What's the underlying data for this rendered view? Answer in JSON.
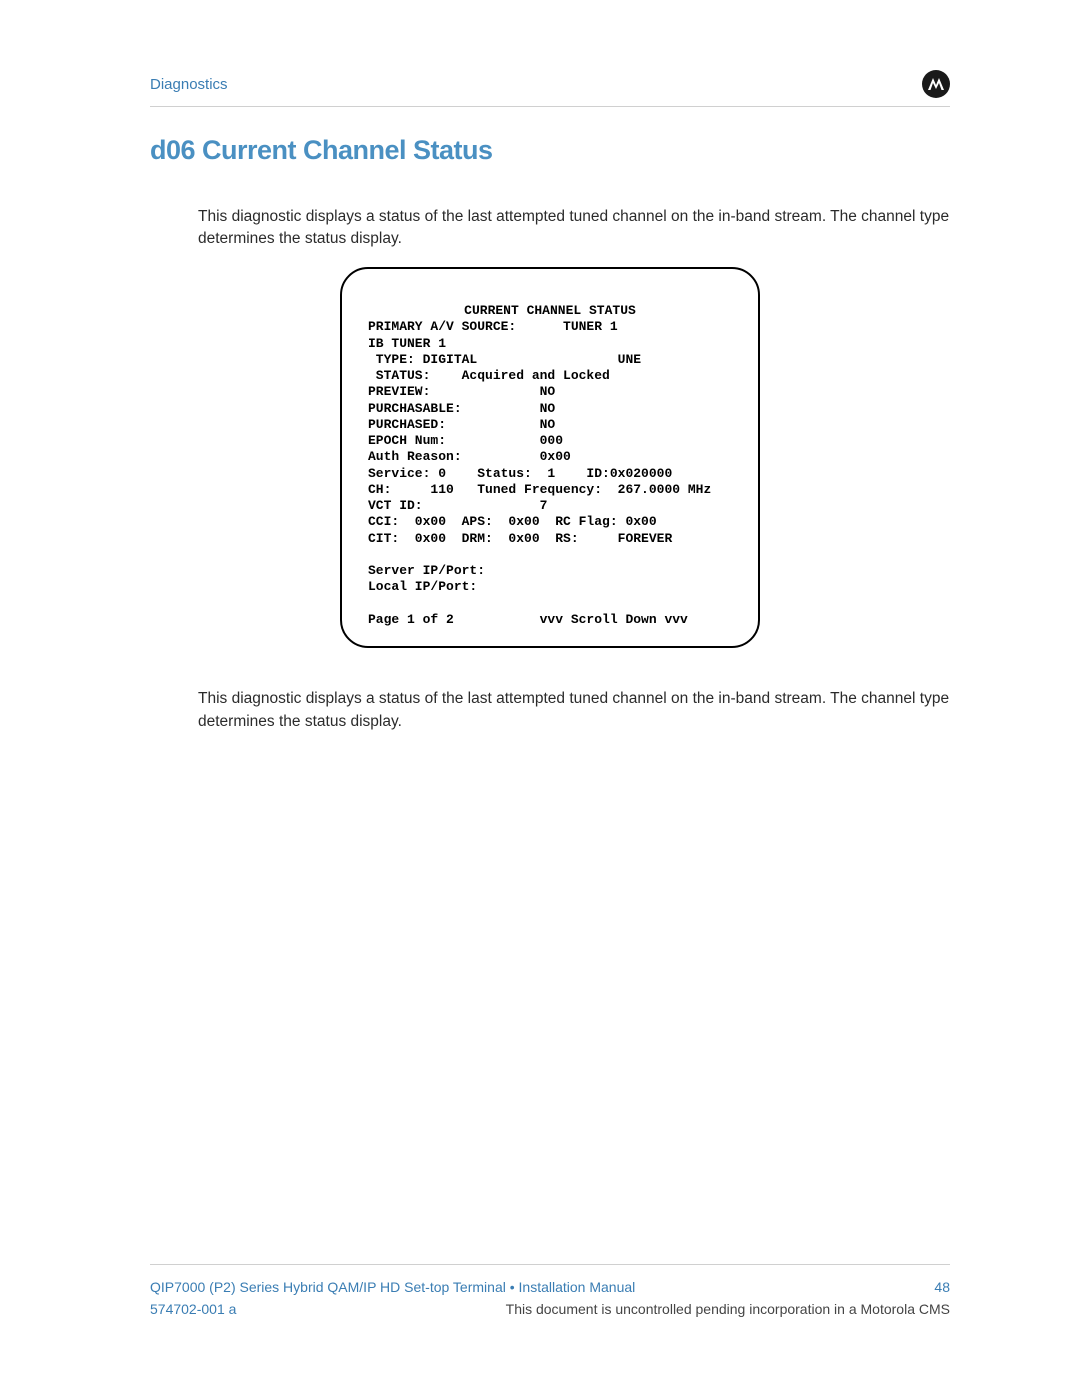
{
  "header": {
    "section_label": "Diagnostics"
  },
  "title": "d06 Current Channel Status",
  "paragraph_intro": "This diagnostic displays a status of the last attempted tuned channel on the in-band stream. The channel type determines the status display.",
  "paragraph_after": "This diagnostic displays a status of the last attempted tuned channel on the in-band stream. The channel type determines the status display.",
  "screen": {
    "title": "CURRENT CHANNEL STATUS",
    "l1": "PRIMARY A/V SOURCE:      TUNER 1",
    "l2": "IB TUNER 1",
    "l3": " TYPE: DIGITAL                  UNE",
    "l4": " STATUS:    Acquired and Locked",
    "l5": "PREVIEW:              NO",
    "l6": "PURCHASABLE:          NO",
    "l7": "PURCHASED:            NO",
    "l8": "EPOCH Num:            000",
    "l9": "Auth Reason:          0x00",
    "l10": "Service: 0    Status:  1    ID:0x020000",
    "l11": "CH:     110   Tuned Frequency:  267.0000 MHz",
    "l12": "VCT ID:               7",
    "l13": "CCI:  0x00  APS:  0x00  RC Flag: 0x00",
    "l14": "CIT:  0x00  DRM:  0x00  RS:     FOREVER",
    "l15": " ",
    "l16": "Server IP/Port:",
    "l17": "Local IP/Port:",
    "l18": " ",
    "l19": "Page 1 of 2           vvv Scroll Down vvv"
  },
  "footer": {
    "manual_title": "QIP7000 (P2) Series Hybrid QAM/IP HD Set-top Terminal • Installation Manual",
    "page_number": "48",
    "doc_number": "574702-001 a",
    "notice": "This document is uncontrolled pending incorporation in a Motorola CMS"
  }
}
